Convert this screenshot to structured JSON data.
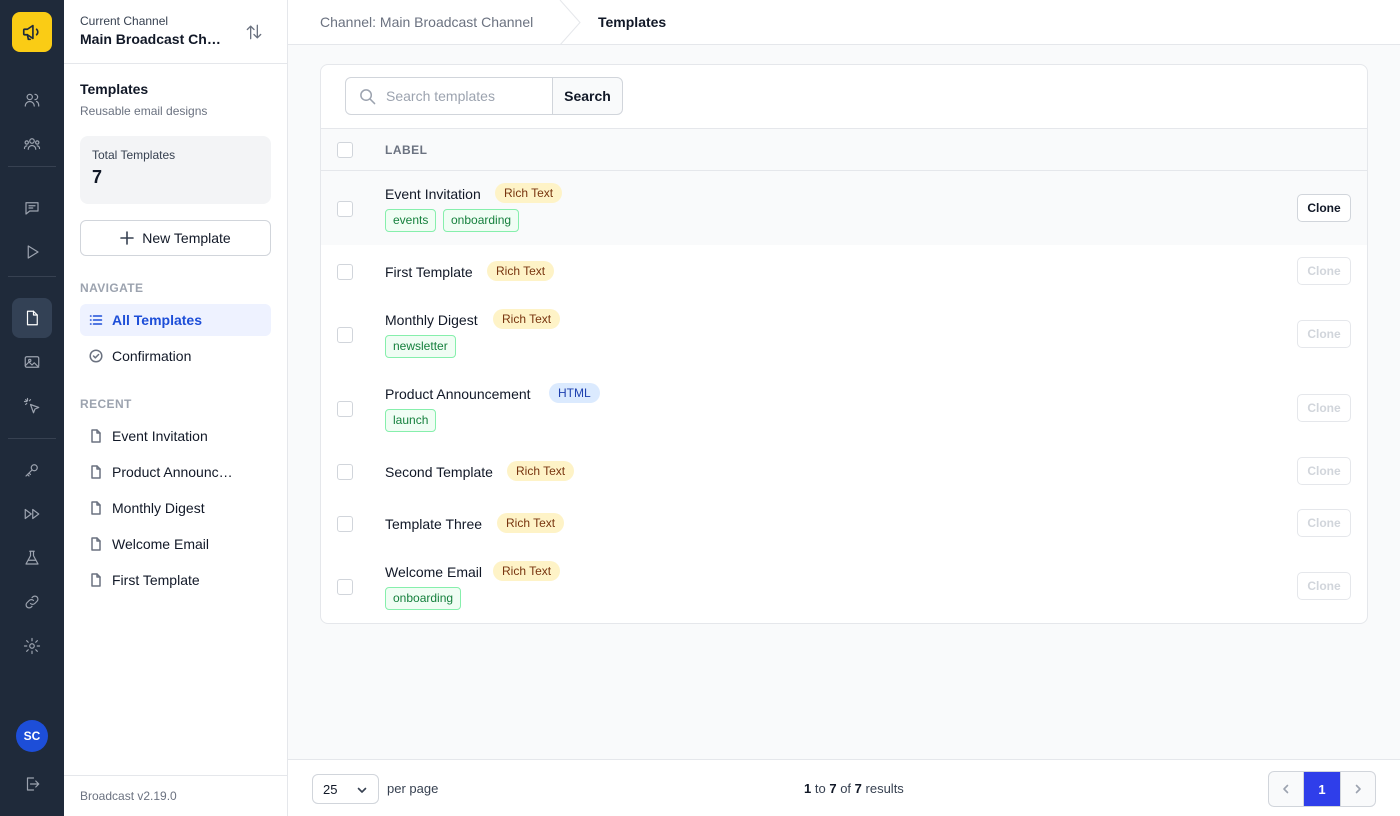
{
  "rail": {
    "logo_icon": "megaphone-icon",
    "items": [
      "users-icon",
      "group-icon",
      "chat-icon",
      "play-icon",
      "document-icon",
      "image-icon",
      "cursor-click-icon",
      "key-icon",
      "fast-forward-icon",
      "beaker-icon",
      "link-icon",
      "gear-icon"
    ],
    "active": "document-icon",
    "avatar_initials": "SC",
    "logout_icon": "logout-icon"
  },
  "sidebar": {
    "channel_caption": "Current Channel",
    "channel_name": "Main Broadcast Channel",
    "title": "Templates",
    "subtitle": "Reusable email designs",
    "stat_label": "Total Templates",
    "stat_value": "7",
    "new_button": "New Template",
    "navigate_heading": "NAVIGATE",
    "nav": [
      {
        "label": "All Templates",
        "icon": "list-icon",
        "active": true
      },
      {
        "label": "Confirmation",
        "icon": "check-circle-icon",
        "active": false
      }
    ],
    "recent_heading": "RECENT",
    "recent": [
      {
        "label": "Event Invitation"
      },
      {
        "label": "Product Announcement"
      },
      {
        "label": "Monthly Digest"
      },
      {
        "label": "Welcome Email"
      },
      {
        "label": "First Template"
      }
    ],
    "version": "Broadcast v2.19.0"
  },
  "breadcrumb": {
    "channel": "Channel: Main Broadcast Channel",
    "current": "Templates"
  },
  "search": {
    "placeholder": "Search templates",
    "value": "",
    "button": "Search"
  },
  "table": {
    "header_label": "LABEL",
    "clone_label": "Clone",
    "rows": [
      {
        "name": "Event Invitation",
        "type": "Rich Text",
        "tags": [
          "events",
          "onboarding"
        ],
        "hover": true
      },
      {
        "name": "First Template",
        "type": "Rich Text",
        "tags": []
      },
      {
        "name": "Monthly Digest",
        "type": "Rich Text",
        "tags": [
          "newsletter"
        ]
      },
      {
        "name": "Product Announcement",
        "type": "HTML",
        "tags": [
          "launch"
        ]
      },
      {
        "name": "Second Template",
        "type": "Rich Text",
        "tags": []
      },
      {
        "name": "Template Three",
        "type": "Rich Text",
        "tags": []
      },
      {
        "name": "Welcome Email",
        "type": "Rich Text",
        "tags": [
          "onboarding"
        ]
      }
    ]
  },
  "footer": {
    "per_page_value": "25",
    "per_page_label": "per page",
    "results_from": "1",
    "results_to_word": "to",
    "results_to": "7",
    "results_of_word": "of",
    "results_total": "7",
    "results_word": "results",
    "current_page": "1"
  },
  "colors": {
    "rail_bg": "#1f2a3a",
    "logo_bg": "#facc15",
    "accent": "#2f3eea",
    "rich_badge_bg": "#fef3c7",
    "html_badge_bg": "#dbeafe",
    "tag_green": "#15803d"
  }
}
